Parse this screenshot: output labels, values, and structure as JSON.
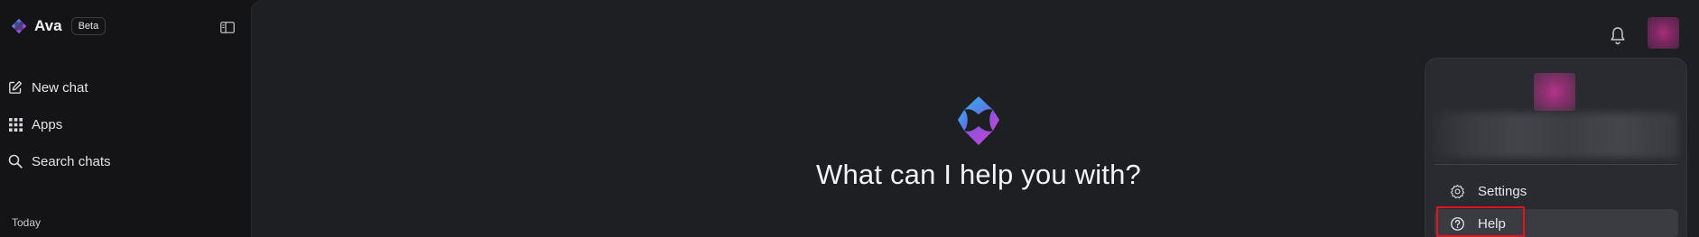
{
  "brand": {
    "name": "Ava",
    "badge": "Beta"
  },
  "sidebar": {
    "items": [
      {
        "label": "New chat",
        "icon": "edit-icon"
      },
      {
        "label": "Apps",
        "icon": "grid-icon"
      },
      {
        "label": "Search chats",
        "icon": "search-icon"
      }
    ],
    "section_label": "Today"
  },
  "main": {
    "greeting": "What can I help you with?"
  },
  "user_menu": {
    "items": [
      {
        "label": "Settings",
        "icon": "gear-icon"
      },
      {
        "label": "Help",
        "icon": "help-circle-icon"
      }
    ]
  },
  "colors": {
    "background": "#1e1f23",
    "sidebar": "#141416",
    "menu": "#2a2b30",
    "logo_gradient": [
      "#3aa6e6",
      "#7b5ae0",
      "#c048d6"
    ],
    "highlight": "#e0141e"
  }
}
